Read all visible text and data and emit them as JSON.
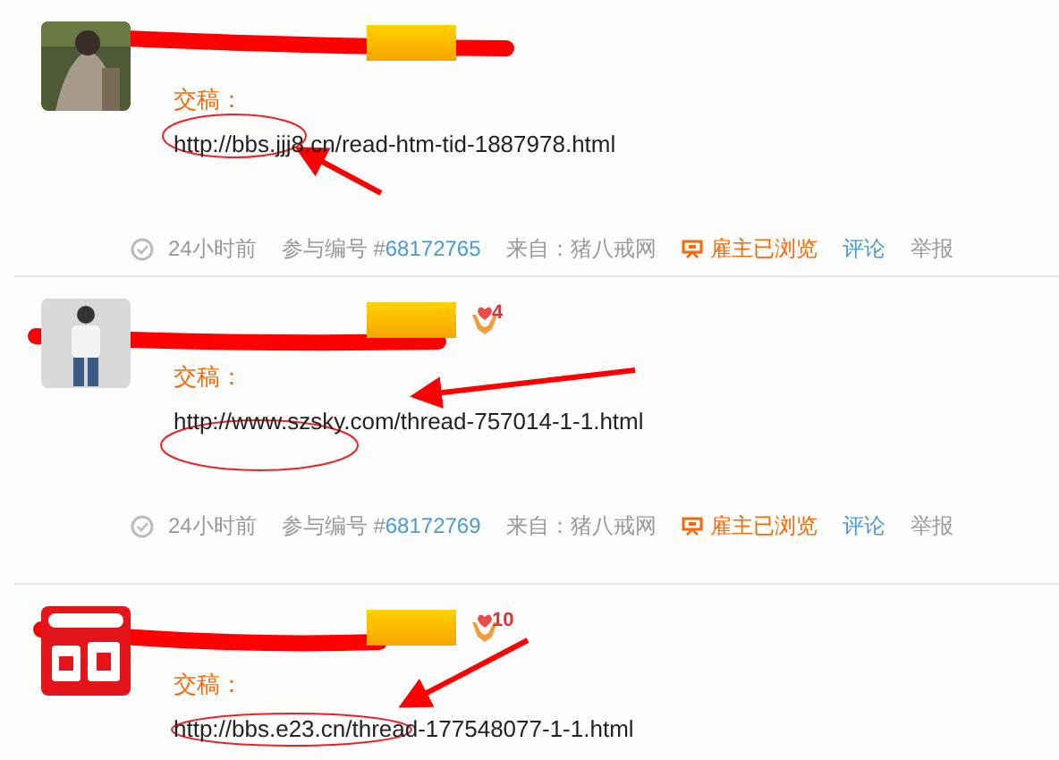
{
  "entries": [
    {
      "level_badge": true,
      "label": "交稿：",
      "url": "http://bbs.jjj8.cn/read-htm-tid-1887978.html",
      "meta": {
        "time": "24小时前",
        "number_label": "参与编号 #",
        "number": "68172765",
        "source": "来自：猪八戒网",
        "viewed": "雇主已浏览",
        "comment": "评论",
        "report": "举报"
      }
    },
    {
      "level_badge": true,
      "hands_count": "4",
      "label": "交稿：",
      "url": "http://www.szsky.com/thread-757014-1-1.html",
      "meta": {
        "time": "24小时前",
        "number_label": "参与编号 #",
        "number": "68172769",
        "source": "来自：猪八戒网",
        "viewed": "雇主已浏览",
        "comment": "评论",
        "report": "举报"
      }
    },
    {
      "level_badge": true,
      "hands_count": "10",
      "label": "交稿：",
      "url": "http://bbs.e23.cn/thread-177548077-1-1.html"
    }
  ]
}
